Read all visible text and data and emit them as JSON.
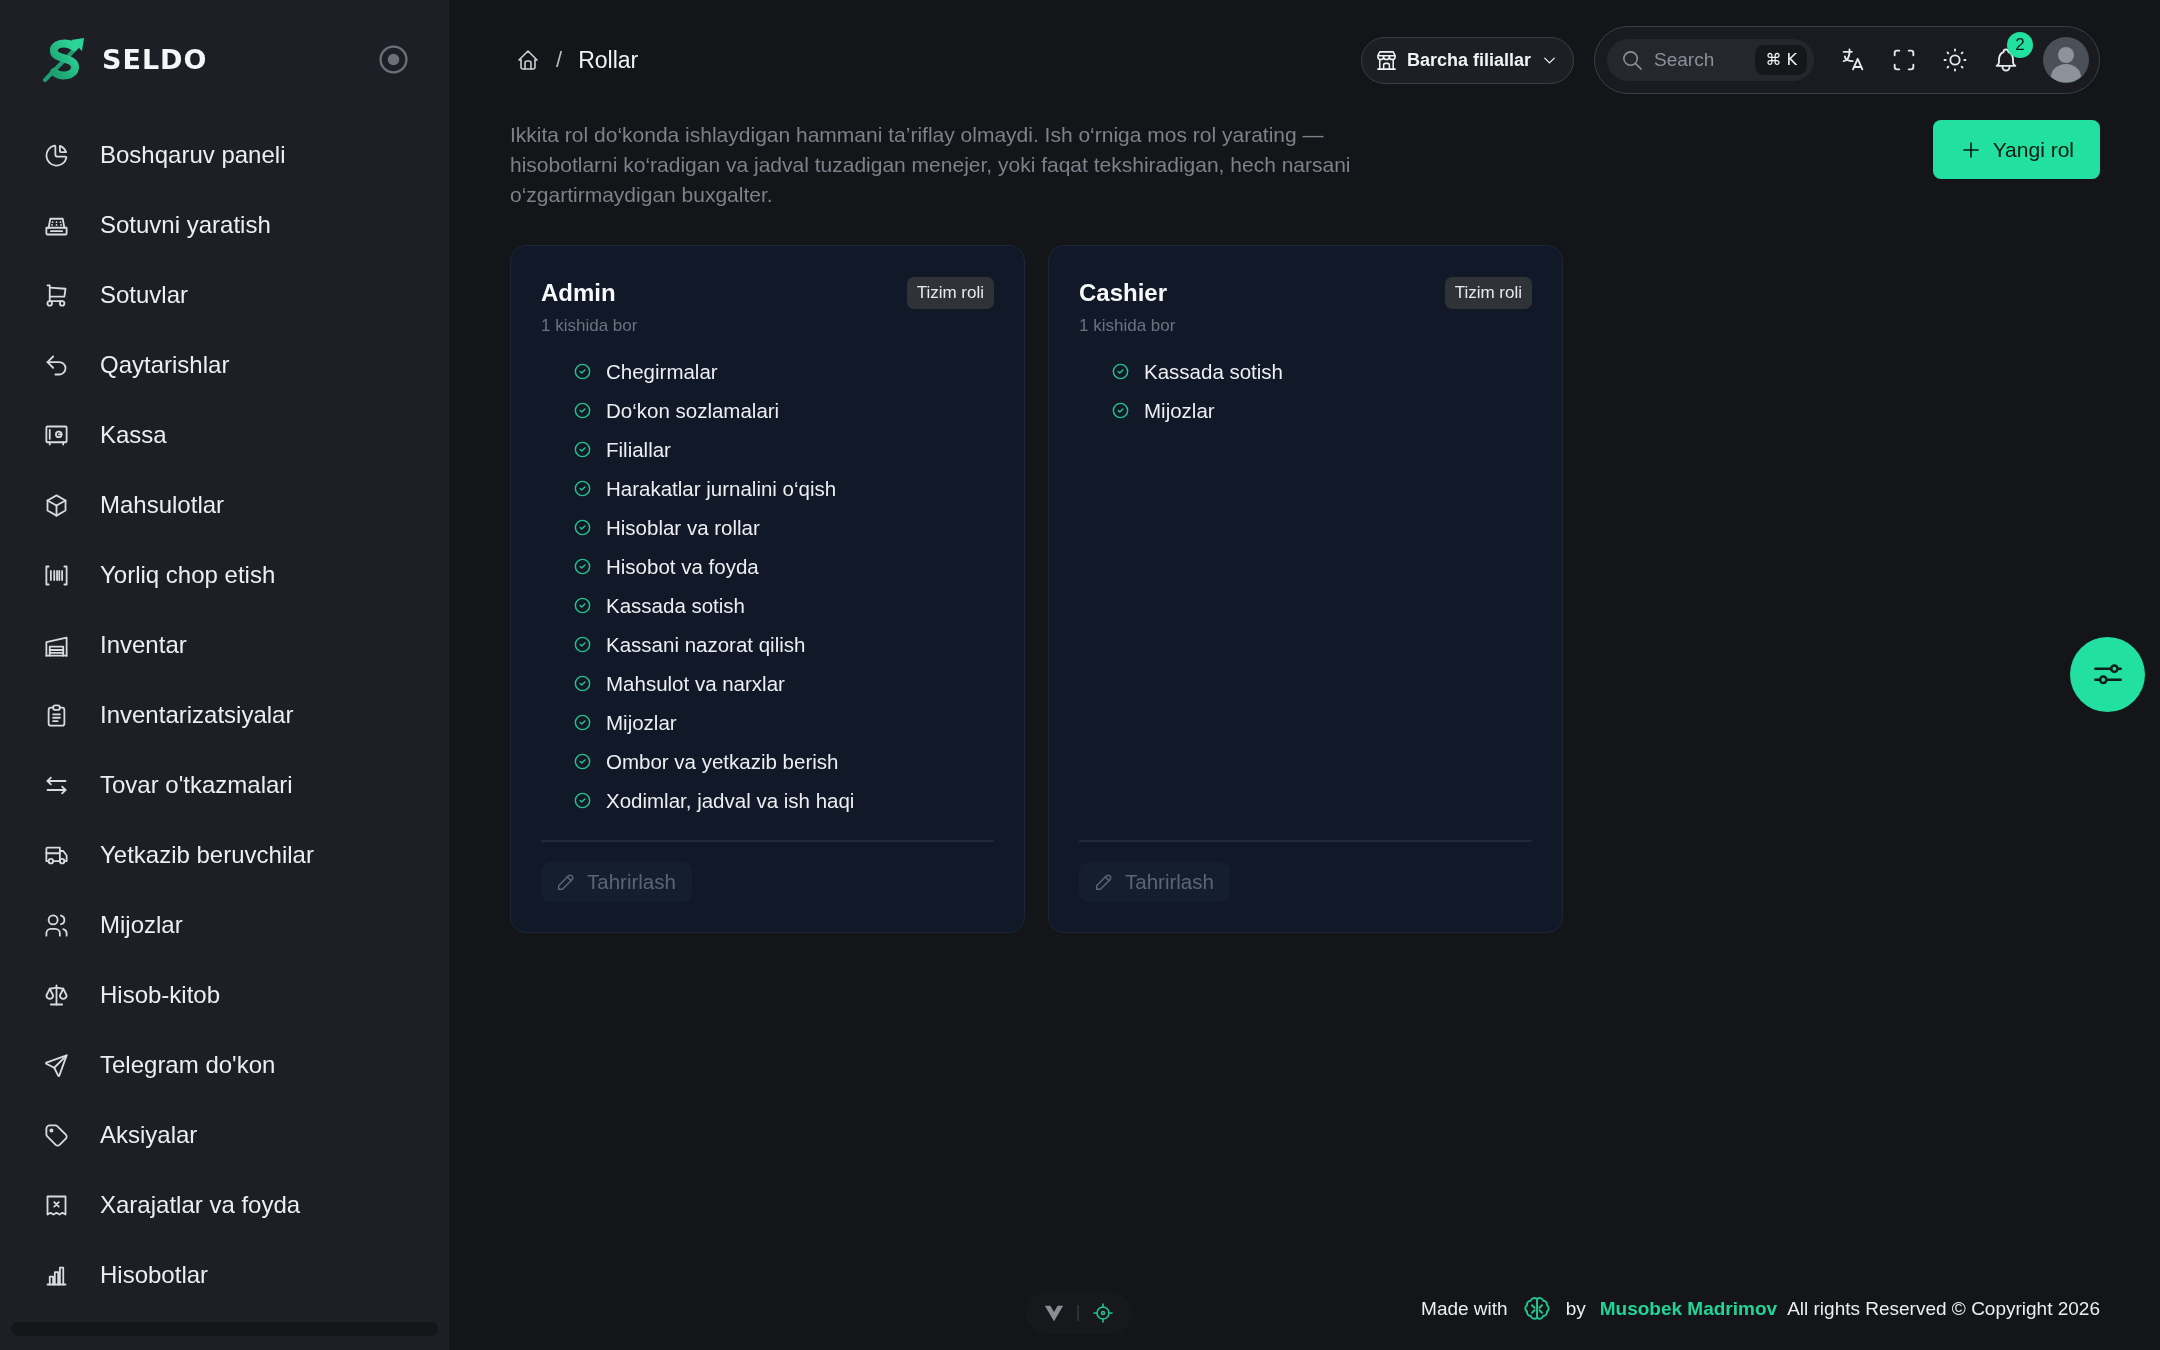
{
  "sidebar": {
    "brand": "SELDO",
    "items": [
      {
        "label": "Boshqaruv paneli",
        "selected": false
      },
      {
        "label": "Sotuvni yaratish",
        "selected": false
      },
      {
        "label": "Sotuvlar",
        "selected": false
      },
      {
        "label": "Qaytarishlar",
        "selected": false
      },
      {
        "label": "Kassa",
        "selected": false
      },
      {
        "label": "Mahsulotlar",
        "selected": false
      },
      {
        "label": "Yorliq chop etish",
        "selected": false
      },
      {
        "label": "Inventar",
        "selected": false
      },
      {
        "label": "Inventarizatsiyalar",
        "selected": false
      },
      {
        "label": "Tovar o'tkazmalari",
        "selected": false
      },
      {
        "label": "Yetkazib beruvchilar",
        "selected": false
      },
      {
        "label": "Mijozlar",
        "selected": false
      },
      {
        "label": "Hisob-kitob",
        "selected": false
      },
      {
        "label": "Telegram do'kon",
        "selected": false
      },
      {
        "label": "Aksiyalar",
        "selected": false
      },
      {
        "label": "Xarajatlar va foyda",
        "selected": false
      },
      {
        "label": "Hisobotlar",
        "selected": false
      }
    ]
  },
  "header": {
    "breadcrumb": {
      "separator": "/",
      "current": "Rollar"
    },
    "branch_select": {
      "value": "Barcha filiallar"
    },
    "search": {
      "placeholder": "Search",
      "shortcut": "⌘ K"
    },
    "notifications": {
      "count": "2"
    }
  },
  "intro": {
    "description": "Ikkita rol do‘konda ishlaydigan hammani ta’riflay olmaydi. Ish o‘rniga mos rol yarating — hisobotlarni ko‘radigan va jadval tuzadigan menejer, yoki faqat tekshiradigan, hech narsani o‘zgartirmaydigan buxgalter.",
    "new_role_button": "Yangi rol"
  },
  "roles": [
    {
      "name": "Admin",
      "badge": "Tizim roli",
      "members": "1 kishida bor",
      "permissions": [
        "Chegirmalar",
        "Do‘kon sozlamalari",
        "Filiallar",
        "Harakatlar jurnalini o‘qish",
        "Hisoblar va rollar",
        "Hisobot va foyda",
        "Kassada sotish",
        "Kassani nazorat qilish",
        "Mahsulot va narxlar",
        "Mijozlar",
        "Ombor va yetkazib berish",
        "Xodimlar, jadval va ish haqi"
      ],
      "edit_button": {
        "label": "Tahrirlash",
        "disabled": true
      }
    },
    {
      "name": "Cashier",
      "badge": "Tizim roli",
      "members": "1 kishida bor",
      "permissions": [
        "Kassada sotish",
        "Mijozlar"
      ],
      "edit_button": {
        "label": "Tahrirlash",
        "disabled": true
      }
    }
  ],
  "footer": {
    "made_with": "Made with",
    "by": "by",
    "author": "Musobek Madrimov",
    "copyright": "All rights Reserved © Copyright 2026"
  }
}
